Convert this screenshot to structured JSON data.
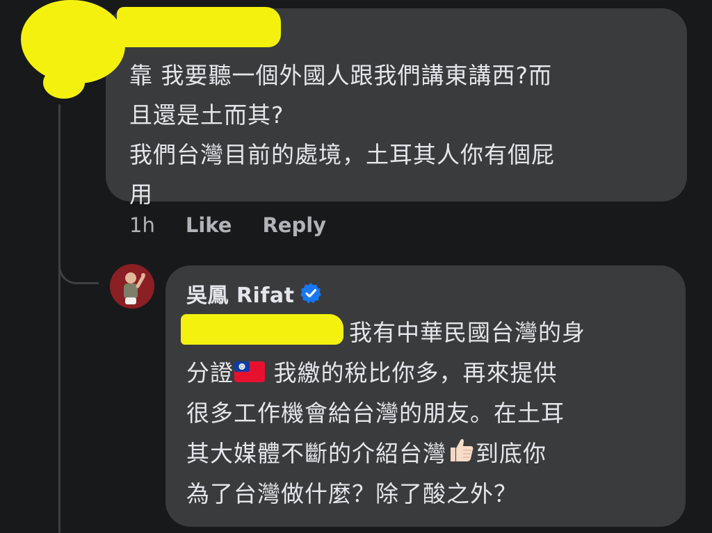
{
  "parent_comment": {
    "lines": [
      "靠 我要聽一個外國人跟我們講東講西?而",
      "且還是土而其?",
      "我們台灣目前的處境，土耳其人你有個屁",
      "用"
    ],
    "time": "1h",
    "like_label": "Like",
    "reply_label": "Reply"
  },
  "reply_comment": {
    "author": "吳鳳 Rifat",
    "text_part_1": "我有中華民國台灣的身",
    "text_part_2": "分證",
    "text_part_3": " 我繳的稅比你多，再來提供",
    "text_part_4": "很多工作機會給台灣的朋友。在土耳",
    "text_part_5": "其大媒體不斷的介紹台灣",
    "text_part_6": "到底你",
    "text_part_7": "為了台灣做什麼？除了酸之外？"
  },
  "icons": {
    "verified": "verified-badge-icon",
    "flag": "taiwan-flag-emoji",
    "thumbs_up": "thumbs-up-emoji"
  },
  "colors": {
    "background": "#18191a",
    "bubble": "#3a3b3c",
    "text": "#e4e6eb",
    "secondary_text": "#b0b3b8",
    "verified_blue": "#1877f2",
    "redaction": "#f4f10f"
  }
}
